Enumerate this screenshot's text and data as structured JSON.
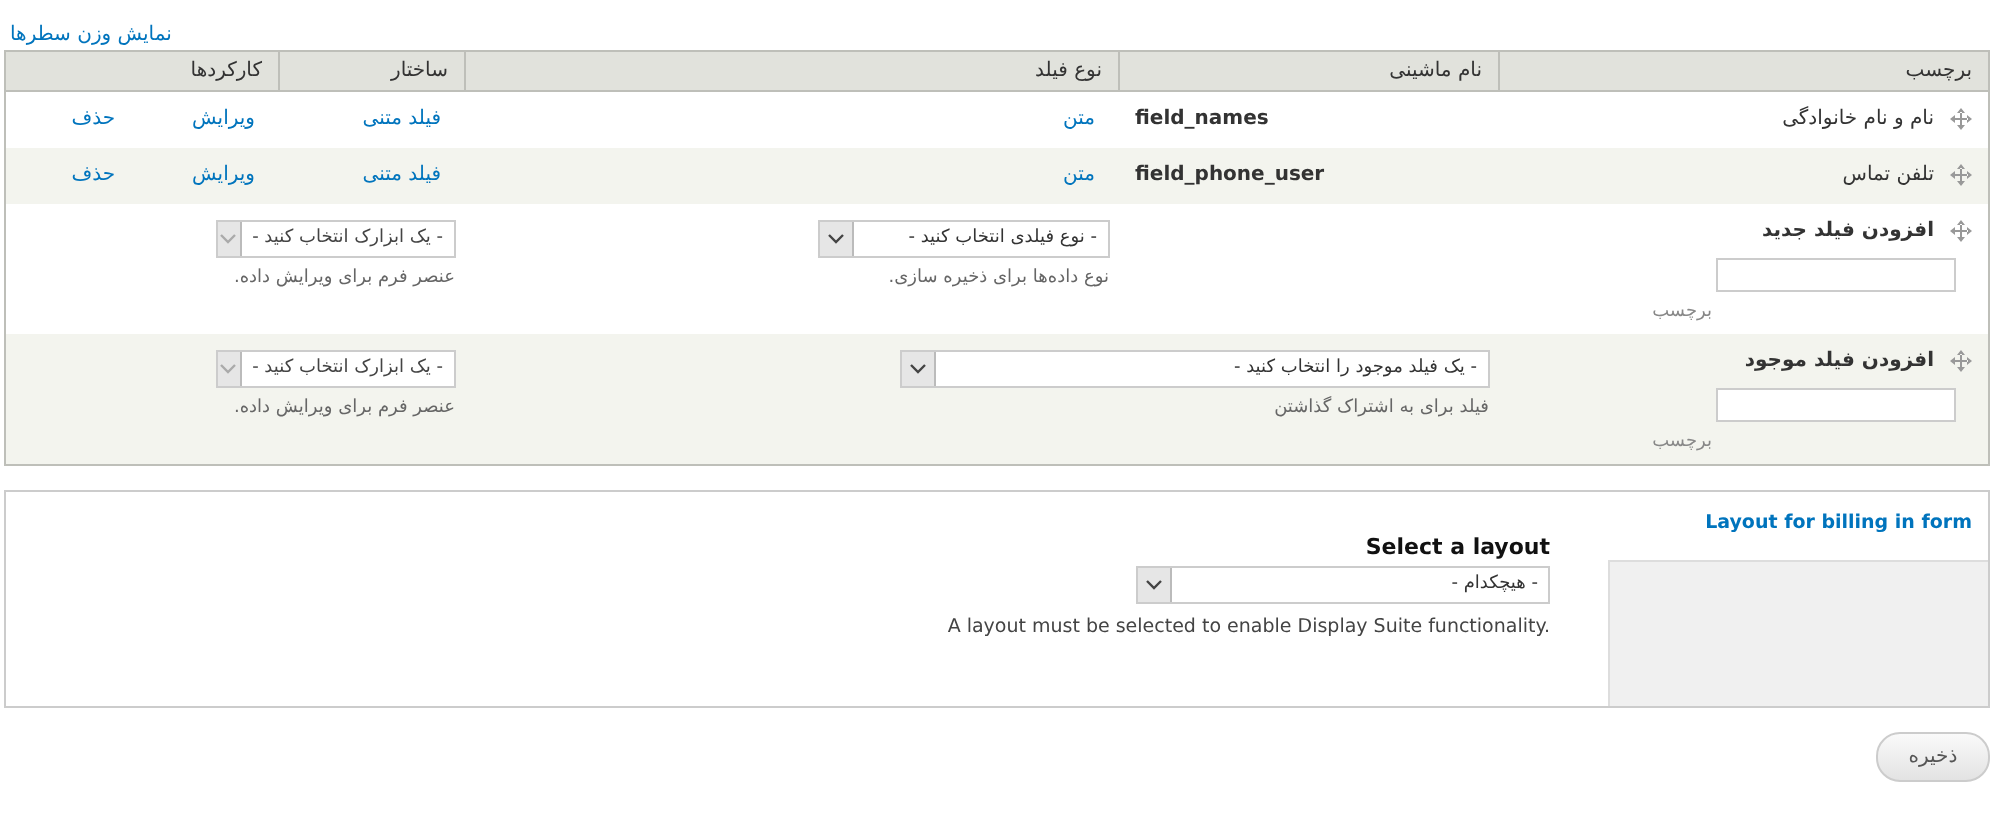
{
  "weight_toggle": "نمایش وزن سطرها",
  "table": {
    "columns": [
      "برچسب",
      "نام ماشینی",
      "نوع فیلد",
      "ساختار",
      "کارکردها"
    ],
    "rows": [
      {
        "label": "نام و نام خانوادگی",
        "machine_name": "field_names",
        "field_type": "متن",
        "widget": "فیلد متنی",
        "operations": [
          "ویرایش",
          "حذف"
        ]
      },
      {
        "label": "تلفن تماس",
        "machine_name": "field_phone_user",
        "field_type": "متن",
        "widget": "فیلد متنی",
        "operations": [
          "ویرایش",
          "حذف"
        ]
      }
    ]
  },
  "add_new": {
    "title": "افزودن فیلد جدید",
    "label_caption": "برچسب",
    "type_select": "- نوع فیلدی انتخاب کنید -",
    "type_hint": "نوع داده‌ها برای ذخیره سازی.",
    "widget_select": {
      "text": "- یک ابزارک انتخاب کنید -",
      "disabled": true
    },
    "widget_hint": "عنصر فرم برای ویرایش داده."
  },
  "add_existing": {
    "title": "افزودن فیلد موجود",
    "label_caption": "برچسب",
    "field_select": "- یک فیلد موجود را انتخاب کنید -",
    "field_hint": "فیلد برای به اشتراک گذاشتن",
    "widget_select": {
      "text": "- یک ابزارک انتخاب کنید -",
      "disabled": true
    },
    "widget_hint": "عنصر فرم برای ویرایش داده."
  },
  "layout": {
    "title": "Layout for billing in form",
    "heading": "Select a layout",
    "select": "- هیچکدام -",
    "description": "A layout must be selected to enable Display Suite functionality."
  },
  "save_button": "ذخیره"
}
